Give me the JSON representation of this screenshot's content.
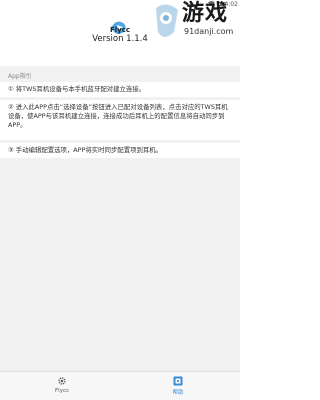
{
  "status_bar": {
    "time": "4:02"
  },
  "watermark": {
    "title": "游戏",
    "site": "91danji.com"
  },
  "app": {
    "name": "Flycc",
    "version": "Version 1.1.4"
  },
  "guide": {
    "section_label": "App指引",
    "items": [
      "① 将TWS耳机设备与本手机蓝牙配对建立连接。",
      "② 进入此APP点击“选择设备”按钮进入已配对设备列表，点击对应的TWS耳机设备，使APP与该耳机建立连接，连接成功后耳机上的配置信息将自动同步到APP。",
      "③ 手动编辑配置选项，APP将实时同步配置项到耳机。"
    ]
  },
  "tabs": [
    {
      "label": "Flycc",
      "icon": "gear-icon",
      "active": false
    },
    {
      "label": "帮助",
      "icon": "help-icon",
      "active": true
    }
  ],
  "colors": {
    "accent": "#3a8bd6",
    "background": "#f1f1f1"
  }
}
